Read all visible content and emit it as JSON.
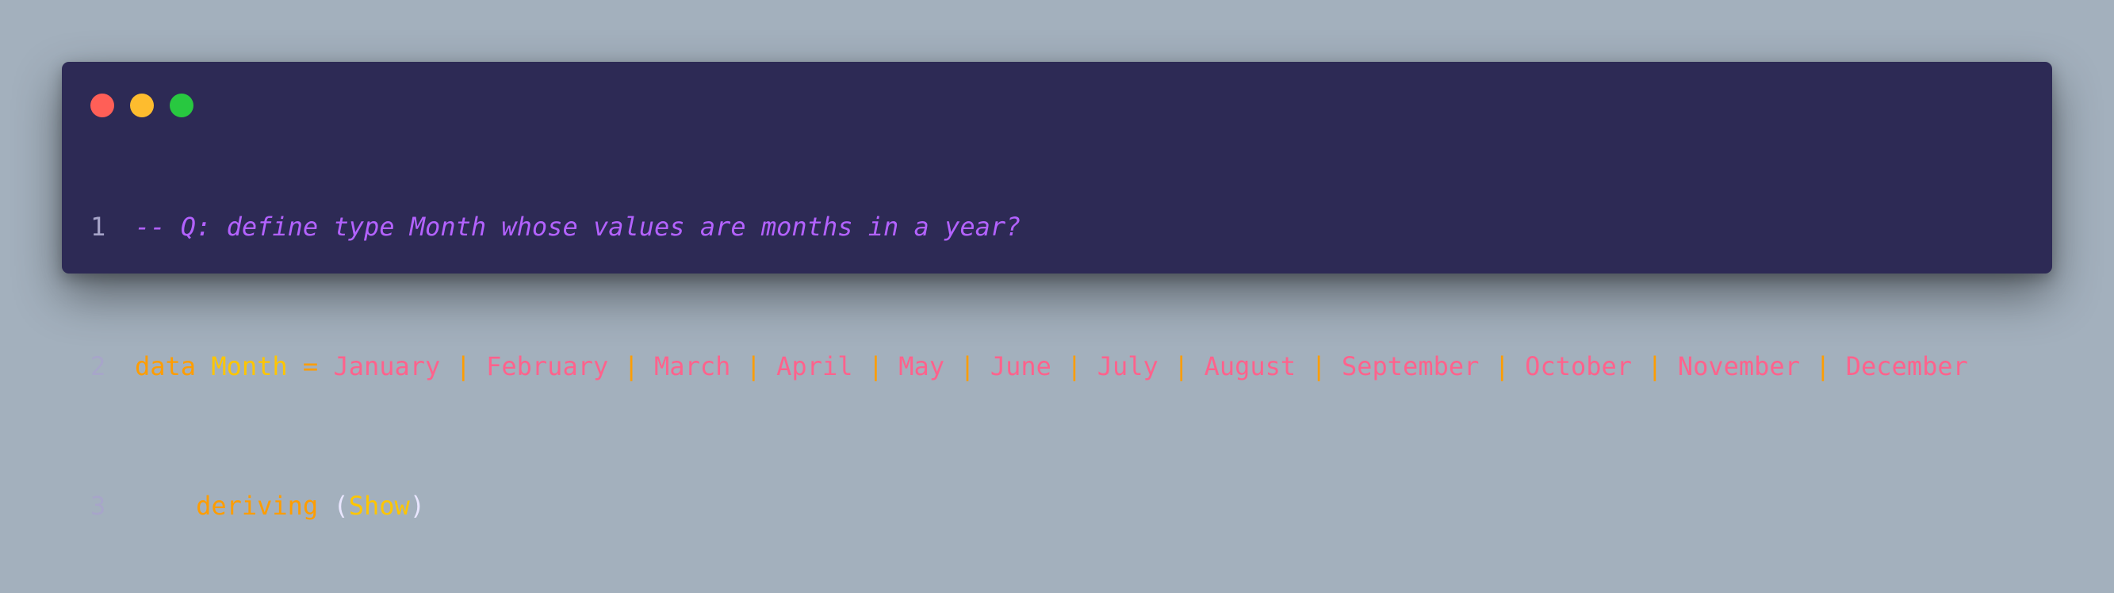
{
  "window": {
    "controls": [
      {
        "name": "close",
        "color": "#ff5f57"
      },
      {
        "name": "minimize",
        "color": "#febc2e"
      },
      {
        "name": "zoom",
        "color": "#28c840"
      }
    ]
  },
  "code": {
    "lines": [
      {
        "number": "1",
        "comment": "-- Q: define type Month whose values are months in a year?"
      },
      {
        "number": "2",
        "keyword": "data",
        "type_name": "Month",
        "equals": "=",
        "separator": "|",
        "constructors": [
          "January",
          "February",
          "March",
          "April",
          "May",
          "June",
          "July",
          "August",
          "September",
          "October",
          "November",
          "December"
        ]
      },
      {
        "number": "3",
        "keyword": "deriving",
        "open_paren": "(",
        "class_name": "Show",
        "close_paren": ")"
      }
    ]
  },
  "colors": {
    "background": "#a3b0bd",
    "editor": "#2d2a55",
    "comment": "#b362ff",
    "keyword": "#ff9d00",
    "constructor": "#ff628c",
    "line_number": "#a7a5c9"
  }
}
